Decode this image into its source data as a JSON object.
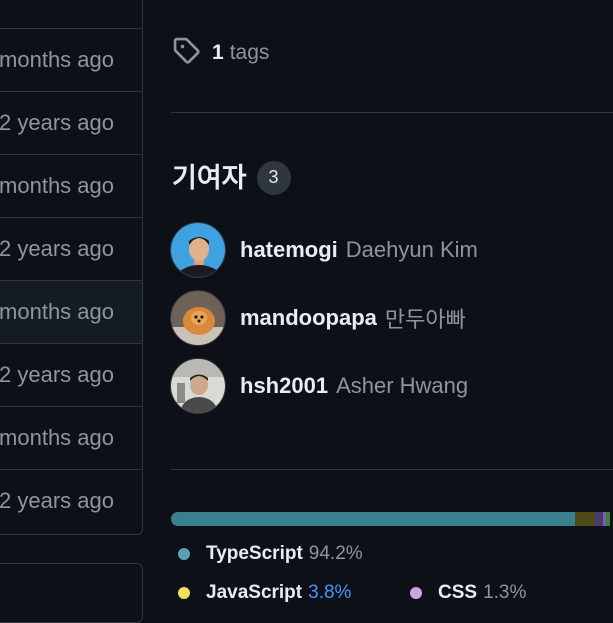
{
  "file_list": {
    "rows": [
      "months ago",
      "2 years ago",
      "months ago",
      "2 years ago",
      "months ago",
      "2 years ago",
      "months ago",
      "2 years ago"
    ]
  },
  "tags": {
    "count": "1",
    "label": "tags"
  },
  "contributors": {
    "title": "기여자",
    "count": "3",
    "list": [
      {
        "login": "hatemogi",
        "name": "Daehyun Kim"
      },
      {
        "login": "mandoopapa",
        "name": "만두아빠"
      },
      {
        "login": "hsh2001",
        "name": "Asher Hwang"
      }
    ]
  },
  "languages": [
    {
      "name": "TypeScript",
      "percent": "94.2%",
      "color": "#3178c6"
    },
    {
      "name": "JavaScript",
      "percent": "3.8%",
      "color": "#f1e05a"
    },
    {
      "name": "CSS",
      "percent": "1.3%",
      "color": "#563d7c"
    }
  ],
  "colors": {
    "background": "#0d1117",
    "border": "#30363d",
    "muted_text": "#8d96a0",
    "link": "#4493f8",
    "typescript_bar": "#3a7f8e",
    "javascript_bar": "#4e4a17",
    "css_bar": "#4a3b6b"
  }
}
